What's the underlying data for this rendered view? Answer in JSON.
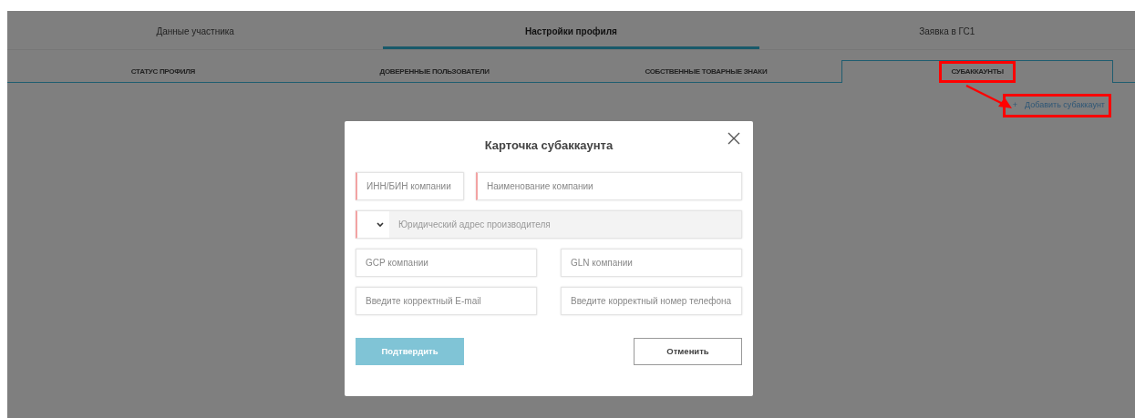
{
  "top_tabs": [
    {
      "label": "Данные участника",
      "selected": false
    },
    {
      "label": "Настройки профиля",
      "selected": true
    },
    {
      "label": "Заявка в ГС1",
      "selected": false
    }
  ],
  "sub_tabs": [
    {
      "label": "СТАТУС ПРОФИЛЯ",
      "selected": false,
      "highlighted": false
    },
    {
      "label": "ДОВЕРЕННЫЕ ПОЛЬЗОВАТЕЛИ",
      "selected": false,
      "highlighted": false
    },
    {
      "label": "СОБСТВЕННЫЕ ТОВАРНЫЕ ЗНАКИ",
      "selected": false,
      "highlighted": false
    },
    {
      "label": "СУБАККАУНТЫ",
      "selected": true,
      "highlighted": true
    }
  ],
  "add_button": {
    "icon": "+",
    "label": "Добавить субаккаунт",
    "highlighted": true
  },
  "modal": {
    "title": "Карточка субаккаунта",
    "field_rows": [
      [
        {
          "kind": "text",
          "placeholder": "ИНН/БИН компании",
          "required": true
        },
        {
          "kind": "text",
          "placeholder": "Наименование компании",
          "required": true
        }
      ],
      [
        {
          "kind": "address",
          "placeholder": "Юридический адрес производителя",
          "required": true,
          "disabled": true
        }
      ],
      [
        {
          "kind": "text",
          "placeholder": "GCP компании",
          "required": false
        },
        {
          "kind": "text",
          "placeholder": "GLN компании",
          "required": false
        }
      ],
      [
        {
          "kind": "text",
          "placeholder": "Введите корректный E-mail",
          "required": false
        },
        {
          "kind": "text",
          "placeholder": "Введите корректный номер телефона",
          "required": false
        }
      ]
    ],
    "buttons": [
      {
        "label": "Подтвердить",
        "kind": "primary",
        "disabled": true
      },
      {
        "label": "Отменить",
        "kind": "secondary"
      }
    ]
  }
}
